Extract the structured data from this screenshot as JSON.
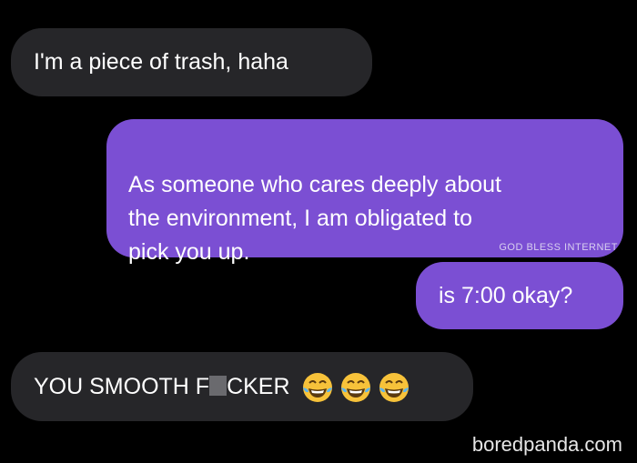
{
  "conversation": {
    "messages": [
      {
        "sender": "other",
        "text": "I'm a piece of trash, haha"
      },
      {
        "sender": "me",
        "text": "As someone who cares deeply about\nthe environment, I am obligated to\npick you up."
      },
      {
        "sender": "me",
        "text": "is 7:00 okay?"
      },
      {
        "sender": "other",
        "text_before": "YOU SMOOTH F",
        "text_after": "CKER",
        "emoji": [
          "tears-of-joy",
          "tears-of-joy",
          "tears-of-joy"
        ]
      }
    ]
  },
  "watermarks": {
    "overlay": "GOD BLESS INTERNET",
    "site": "boredpanda.com"
  },
  "colors": {
    "background": "#000000",
    "incoming_bubble": "#262629",
    "outgoing_bubble": "#7b4fd3",
    "text": "#ffffff"
  }
}
